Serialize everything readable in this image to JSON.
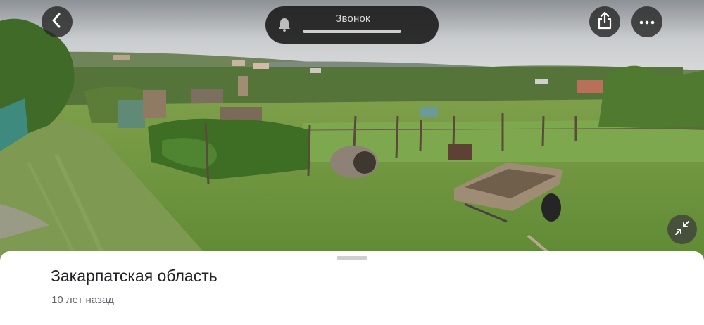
{
  "topbar": {
    "back_icon": "chevron-left-icon",
    "call": {
      "icon": "bell-icon",
      "label": "Звонок"
    },
    "share_icon": "share-icon",
    "more_icon": "more-horizontal-icon"
  },
  "photo": {
    "collapse_icon": "collapse-arrows-icon"
  },
  "sheet": {
    "title": "Закарпатская область",
    "subtitle": "10 лет назад"
  }
}
